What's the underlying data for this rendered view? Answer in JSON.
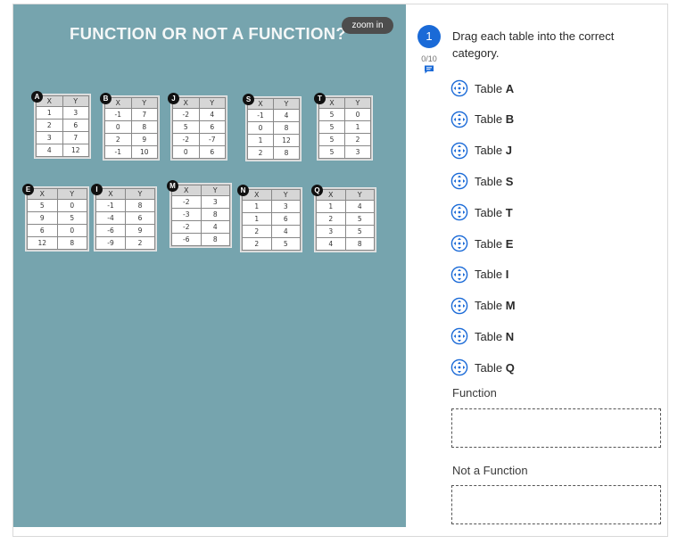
{
  "image": {
    "title": "FUNCTION OR NOT A FUNCTION?",
    "zoom_label": "zoom in",
    "tables": [
      {
        "id": "A",
        "header": [
          "X",
          "Y"
        ],
        "rows": [
          [
            "1",
            "3"
          ],
          [
            "2",
            "6"
          ],
          [
            "3",
            "7"
          ],
          [
            "4",
            "12"
          ]
        ]
      },
      {
        "id": "B",
        "header": [
          "X",
          "Y"
        ],
        "rows": [
          [
            "-1",
            "7"
          ],
          [
            "0",
            "8"
          ],
          [
            "2",
            "9"
          ],
          [
            "-1",
            "10"
          ]
        ]
      },
      {
        "id": "J",
        "header": [
          "X",
          "Y"
        ],
        "rows": [
          [
            "-2",
            "4"
          ],
          [
            "5",
            "6"
          ],
          [
            "-2",
            "-7"
          ],
          [
            "0",
            "6"
          ]
        ]
      },
      {
        "id": "S",
        "header": [
          "X",
          "Y"
        ],
        "rows": [
          [
            "-1",
            "4"
          ],
          [
            "0",
            "8"
          ],
          [
            "1",
            "12"
          ],
          [
            "2",
            "8"
          ]
        ]
      },
      {
        "id": "T",
        "header": [
          "X",
          "Y"
        ],
        "rows": [
          [
            "5",
            "0"
          ],
          [
            "5",
            "1"
          ],
          [
            "5",
            "2"
          ],
          [
            "5",
            "3"
          ]
        ]
      },
      {
        "id": "E",
        "header": [
          "X",
          "Y"
        ],
        "rows": [
          [
            "5",
            "0"
          ],
          [
            "9",
            "5"
          ],
          [
            "6",
            "0"
          ],
          [
            "12",
            "8"
          ]
        ]
      },
      {
        "id": "I",
        "header": [
          "X",
          "Y"
        ],
        "rows": [
          [
            "-1",
            "8"
          ],
          [
            "-4",
            "6"
          ],
          [
            "-6",
            "9"
          ],
          [
            "-9",
            "2"
          ]
        ]
      },
      {
        "id": "M",
        "header": [
          "X",
          "Y"
        ],
        "rows": [
          [
            "-2",
            "3"
          ],
          [
            "-3",
            "8"
          ],
          [
            "-2",
            "4"
          ],
          [
            "-6",
            "8"
          ]
        ]
      },
      {
        "id": "N",
        "header": [
          "X",
          "Y"
        ],
        "rows": [
          [
            "1",
            "3"
          ],
          [
            "1",
            "6"
          ],
          [
            "2",
            "4"
          ],
          [
            "2",
            "5"
          ]
        ]
      },
      {
        "id": "Q",
        "header": [
          "X",
          "Y"
        ],
        "rows": [
          [
            "1",
            "4"
          ],
          [
            "2",
            "5"
          ],
          [
            "3",
            "5"
          ],
          [
            "4",
            "8"
          ]
        ]
      }
    ]
  },
  "question": {
    "number": "1",
    "score": "0/10",
    "prompt": "Drag each table into the correct category.",
    "comment_icon": "comment-icon",
    "items": [
      {
        "prefix": "Table",
        "name": "A"
      },
      {
        "prefix": "Table",
        "name": "B"
      },
      {
        "prefix": "Table",
        "name": "J"
      },
      {
        "prefix": "Table",
        "name": "S"
      },
      {
        "prefix": "Table",
        "name": "T"
      },
      {
        "prefix": "Table",
        "name": "E"
      },
      {
        "prefix": "Table",
        "name": "I"
      },
      {
        "prefix": "Table",
        "name": "M"
      },
      {
        "prefix": "Table",
        "name": "N"
      },
      {
        "prefix": "Table",
        "name": "Q"
      }
    ],
    "drag_icon": "drag-move-icon",
    "categories": [
      {
        "label": "Function"
      },
      {
        "label": "Not a Function"
      }
    ]
  },
  "colors": {
    "panel_bg": "#76a4ae",
    "accent": "#1a6ad7",
    "zoom_bg": "#4d4d4d"
  }
}
